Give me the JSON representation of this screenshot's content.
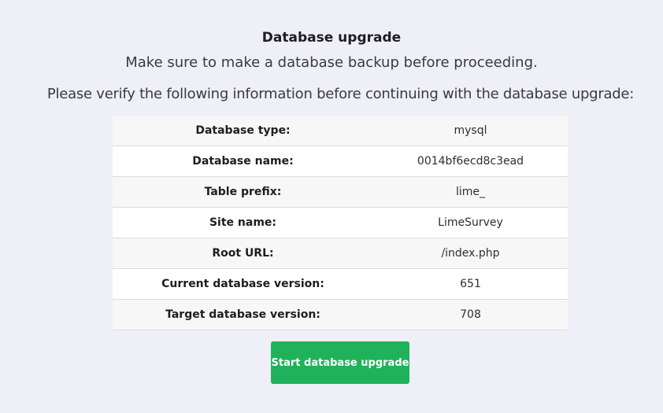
{
  "header": {
    "title": "Database upgrade",
    "subtitle": "Make sure to make a database backup before proceeding.",
    "intro": "Please verify the following information before continuing with the database upgrade:"
  },
  "info_table": {
    "rows": [
      {
        "label": "Database type:",
        "value": "mysql"
      },
      {
        "label": "Database name:",
        "value": "0014bf6ecd8c3ead"
      },
      {
        "label": "Table prefix:",
        "value": "lime_"
      },
      {
        "label": "Site name:",
        "value": "LimeSurvey"
      },
      {
        "label": "Root URL:",
        "value": "/index.php"
      },
      {
        "label": "Current database version:",
        "value": "651"
      },
      {
        "label": "Target database version:",
        "value": "708"
      }
    ]
  },
  "actions": {
    "start_label": "Start database upgrade"
  },
  "colors": {
    "background": "#eeeff7",
    "button": "#1fb25a"
  }
}
